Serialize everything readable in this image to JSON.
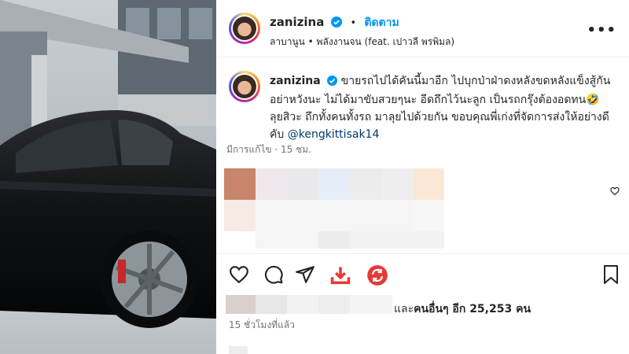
{
  "post": {
    "username": "zanizina",
    "follow_label": "ติดตาม",
    "dot": "•",
    "location": "ลาบานูน • พลังงานจน (feat. เปาวลี พรพิมล)",
    "more_label": "•••"
  },
  "caption": {
    "username": "zanizina",
    "text": "ขายรถไปได้คันนี้มาอีก ไปบุกป่าฝ่าดงหลังขดหลังแข็งสู้กันอย่าหวังนะ ไม่ได้มาขับสวยๆนะ อีดถึกไว้นะลูก เป็นรถกรุ๊งต้องอดทน🤣 ลุยสิวะ ถึกทั้งคนทั้งรถ มาลุยไปด้วยกัน ขอบคุณพี่เก่งที่จัดการส่งให้อย่างดีคับ",
    "mention": "@kengkittisak14",
    "edited": "มีการแก้ไข · 15 ชม."
  },
  "likes": {
    "and_label": "และ",
    "others_label": "คนอื่นๆ อีก 25,253 คน"
  },
  "time_ago": "15 ชั่วโมงที่แล้ว",
  "colors": {
    "accent_blue": "#0095f6",
    "download_red": "#e53935",
    "mention": "#00376b",
    "muted": "#737373"
  },
  "icons": {
    "like": "heart-icon",
    "comment": "comment-icon",
    "share": "send-icon",
    "download": "download-icon",
    "extension": "sync-icon",
    "save": "bookmark-icon",
    "options": "more-icon"
  }
}
